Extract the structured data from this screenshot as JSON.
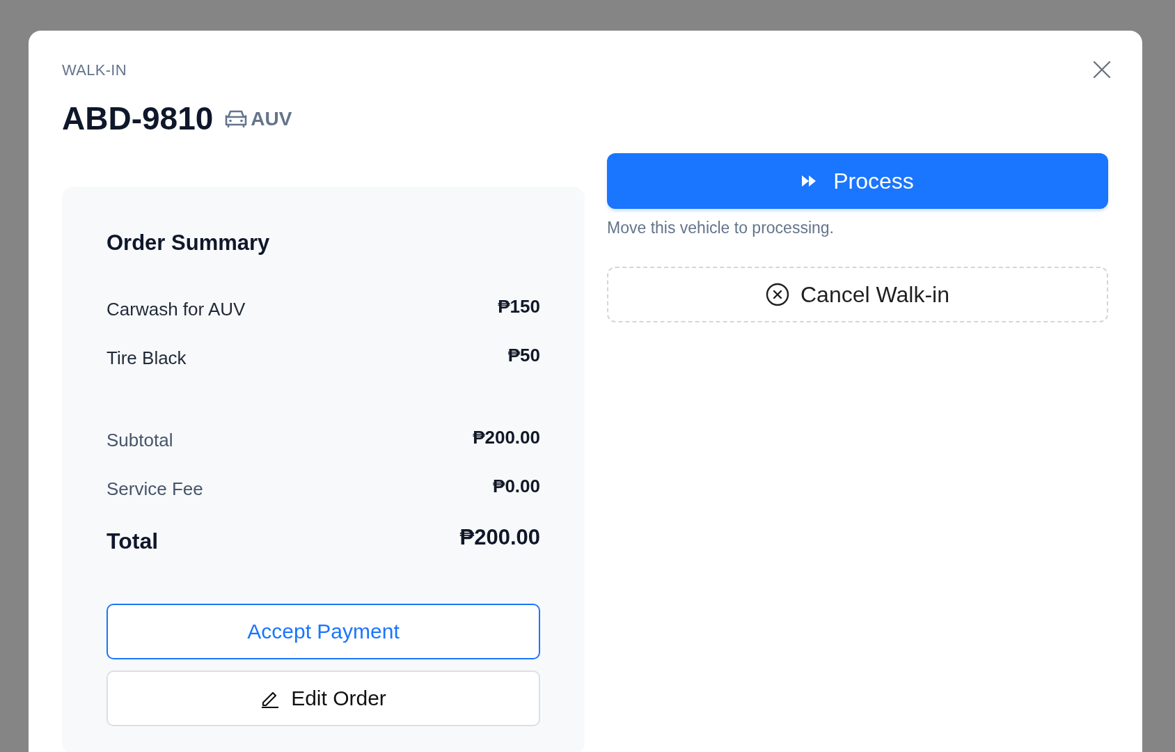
{
  "dialog": {
    "eyebrow": "WALK-IN",
    "plate": "ABD-9810",
    "vehicle_type": "AUV"
  },
  "order_summary": {
    "title": "Order Summary",
    "items": [
      {
        "name": "Carwash for AUV",
        "price": "₱150"
      },
      {
        "name": "Tire Black",
        "price": "₱50"
      }
    ],
    "totals": [
      {
        "kind": "subtotal",
        "label": "Subtotal",
        "amount": "₱200.00"
      },
      {
        "kind": "subtotal",
        "label": "Service Fee",
        "amount": "₱0.00"
      },
      {
        "kind": "total",
        "label": "Total",
        "amount": "₱200.00"
      }
    ],
    "buttons": [
      {
        "kind": "primary-outline",
        "label": "Accept Payment"
      },
      {
        "kind": "edit",
        "label": "Edit Order"
      }
    ]
  },
  "actions": {
    "process": {
      "label": "Process",
      "hint": "Move this vehicle to processing."
    },
    "cancel": {
      "label": "Cancel Walk-in"
    }
  }
}
